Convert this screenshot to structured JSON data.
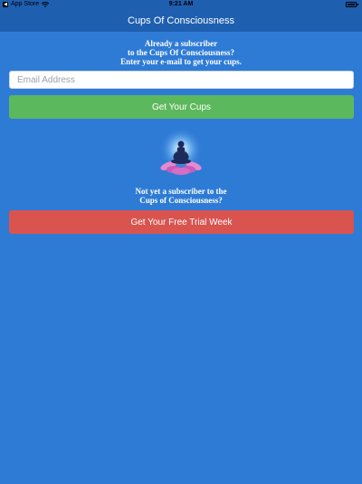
{
  "status_bar": {
    "carrier": "App Store",
    "time": "9:21 AM"
  },
  "nav": {
    "title": "Cups Of Consciousness"
  },
  "subscriber_prompt": {
    "line1": "Already a subscriber",
    "line2": "to the Cups Of Consciousness?",
    "line3": "Enter your e-mail to get your cups."
  },
  "email": {
    "placeholder": "Email Address",
    "value": ""
  },
  "buttons": {
    "get_cups": "Get Your Cups",
    "free_trial": "Get Your Free Trial Week"
  },
  "non_subscriber_prompt": {
    "line1": "Not yet a subscriber to the",
    "line2": "Cups of Consciousness?"
  },
  "colors": {
    "background": "#2e7bd6",
    "nav": "#1f5fb0",
    "green_button": "#5cb85c",
    "red_button": "#d9534f"
  },
  "icons": {
    "logo": "meditation-lotus-icon",
    "wifi": "wifi-icon",
    "battery": "battery-icon",
    "back": "back-to-app-icon"
  }
}
